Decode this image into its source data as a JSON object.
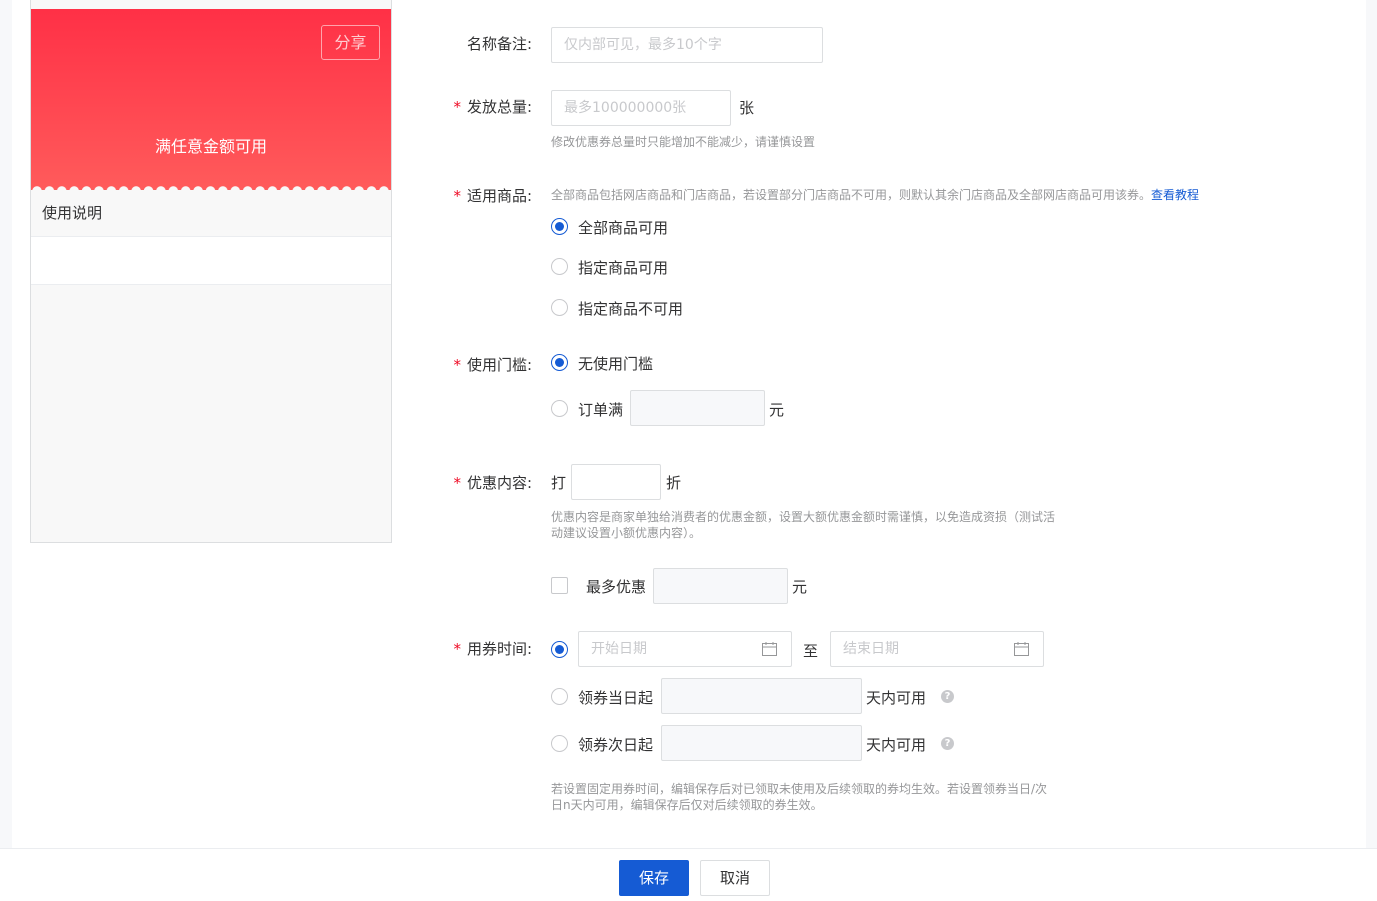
{
  "preview": {
    "share_label": "分享",
    "coupon_desc": "满任意金额可用",
    "usage_title": "使用说明"
  },
  "form": {
    "name_remark": {
      "label": "名称备注:",
      "placeholder": "仅内部可见，最多10个字"
    },
    "total": {
      "label": "发放总量:",
      "placeholder": "最多100000000张",
      "unit": "张",
      "help": "修改优惠券总量时只能增加不能减少，请谨慎设置"
    },
    "goods": {
      "label": "适用商品:",
      "help": "全部商品包括网店商品和门店商品，若设置部分门店商品不可用，则默认其余门店商品及全部网店商品可用该券。",
      "help_link": "查看教程",
      "options": [
        "全部商品可用",
        "指定商品可用",
        "指定商品不可用"
      ],
      "selected": 0
    },
    "threshold": {
      "label": "使用门槛:",
      "options": [
        "无使用门槛",
        "订单满"
      ],
      "unit": "元",
      "selected": 0
    },
    "discount": {
      "label": "优惠内容:",
      "prefix": "打",
      "suffix": "折",
      "help": "优惠内容是商家单独给消费者的优惠金额，设置大额优惠金额时需谨慎，以免造成资损（测试活动建议设置小额优惠内容）。",
      "max_label": "最多优惠",
      "max_unit": "元"
    },
    "time": {
      "label": "用券时间:",
      "start_placeholder": "开始日期",
      "to": "至",
      "end_placeholder": "结束日期",
      "same_day": "领券当日起",
      "next_day": "领券次日起",
      "days_available": "天内可用",
      "help": "若设置固定用券时间，编辑保存后对已领取未使用及后续领取的券均生效。若设置领券当日/次日n天内可用，编辑保存后仅对后续领取的券生效。"
    },
    "required_mark": "*"
  },
  "actions": {
    "save": "保存",
    "cancel": "取消"
  },
  "colors": {
    "primary": "#155bd4",
    "required": "#ee0a24",
    "coupon_top": "#ff3046",
    "coupon_bottom": "#ff5b5b"
  }
}
